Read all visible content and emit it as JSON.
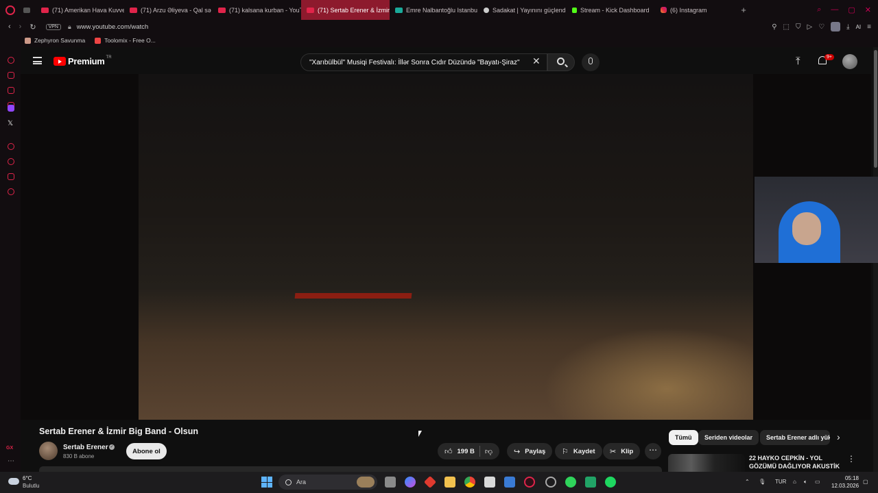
{
  "browser": {
    "tabs": [
      {
        "label": "(71) Amerikan Hava Kuvve",
        "icon": "youtube-icon",
        "active": false
      },
      {
        "label": "(71) Arzu Əliyeva - Qal sə",
        "icon": "youtube-icon",
        "active": false
      },
      {
        "label": "(71) kalsana kurban - YouT",
        "icon": "youtube-icon",
        "active": false
      },
      {
        "label": "(71) Sertab Erener & İzmir",
        "icon": "youtube-icon",
        "active": true
      },
      {
        "label": "Emre Nalbantoğlu Istanbu",
        "icon": "kanban-icon",
        "active": false
      },
      {
        "label": "Sadakat | Yayınını güçlend",
        "icon": "sadakat-icon",
        "active": false
      },
      {
        "label": "Stream - Kick Dashboard",
        "icon": "kick-icon",
        "active": false
      },
      {
        "label": "(6) Instagram",
        "icon": "instagram-icon",
        "active": false
      }
    ],
    "vpn_label": "VPN",
    "url": "www.youtube.com/watch",
    "ai_label": "AI",
    "bookmarks": [
      {
        "label": "Zephyron Savunma"
      },
      {
        "label": "Toolomix - Free O..."
      }
    ],
    "sidebar_gx": "GX"
  },
  "youtube": {
    "logo_text": "Premium",
    "logo_region": "TR",
    "search_value": "\"Xarıbülbül\" Musiqi Festivalı: İllər Sonra Cıdır Düzündə \"Bayatı-Şiraz\"",
    "notification_count": "9+",
    "video": {
      "title": "Sertab Erener & İzmir Big Band - Olsun",
      "channel": "Sertab Erener",
      "subscribers": "830 B abone",
      "subscribe_label": "Abone ol",
      "likes": "199 B",
      "share_label": "Paylaş",
      "save_label": "Kaydet",
      "clip_label": "Klip"
    },
    "chips": [
      {
        "label": "Tümü",
        "active": true
      },
      {
        "label": "Seriden videolar",
        "active": false
      },
      {
        "label": "Sertab Erener adlı yük",
        "active": false
      }
    ],
    "recommendation": {
      "title": "22 HAYKO CEPKİN - YOL GÖZÜMÜ DAĞLIYOR AKUSTİK ..."
    }
  },
  "taskbar": {
    "weather_temp": "6°C",
    "weather_cond": "Bulutlu",
    "search_placeholder": "Ara",
    "language": "TUR",
    "time": "05:18",
    "date": "12.03.2026"
  }
}
